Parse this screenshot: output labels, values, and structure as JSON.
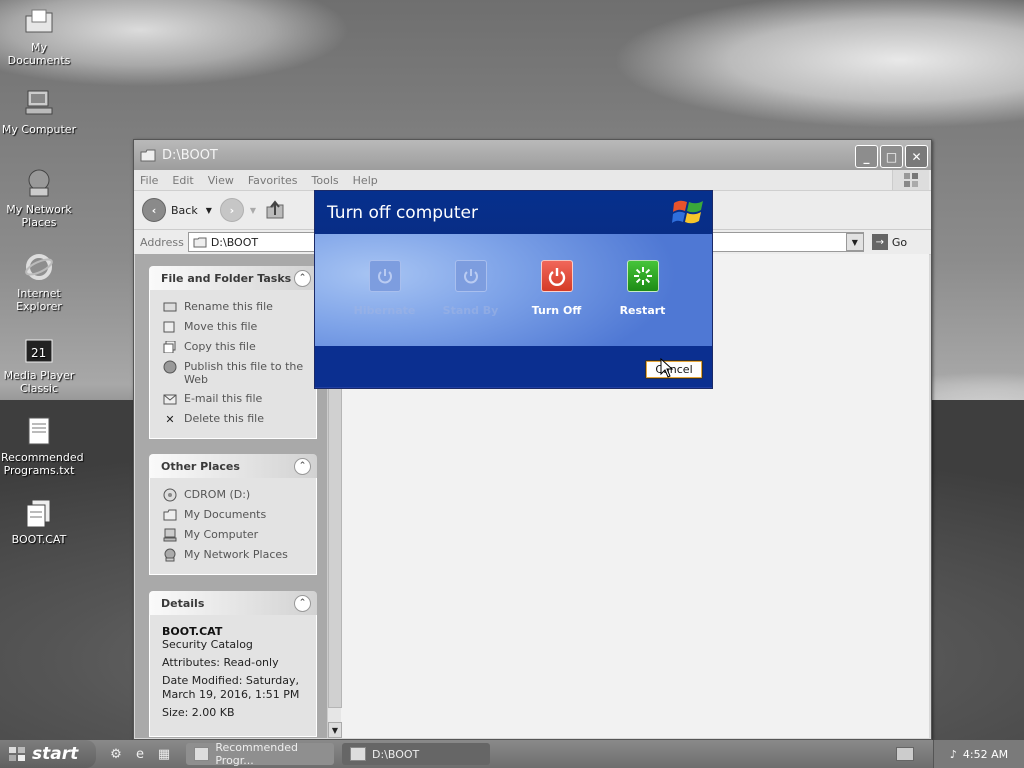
{
  "desktop": {
    "icons": [
      {
        "label": "My Documents",
        "icon": "folder-documents-icon"
      },
      {
        "label": "My Computer",
        "icon": "computer-icon"
      },
      {
        "label": "My Network Places",
        "icon": "network-icon"
      },
      {
        "label": "Internet Explorer",
        "icon": "ie-icon"
      },
      {
        "label": "Media Player Classic",
        "icon": "media-player-icon"
      },
      {
        "label": "Recommended Programs.txt",
        "icon": "text-file-icon"
      },
      {
        "label": "BOOT.CAT",
        "icon": "catalog-file-icon"
      }
    ]
  },
  "window": {
    "title": "D:\\BOOT",
    "menu": [
      "File",
      "Edit",
      "View",
      "Favorites",
      "Tools",
      "Help"
    ],
    "toolbar": {
      "back_label": "Back"
    },
    "address": {
      "label": "Address",
      "value": "D:\\BOOT",
      "go_label": "Go"
    },
    "file_tasks": {
      "title": "File and Folder Tasks",
      "items": [
        "Rename this file",
        "Move this file",
        "Copy this file",
        "Publish this file to the Web",
        "E-mail this file",
        "Delete this file"
      ]
    },
    "other_places": {
      "title": "Other Places",
      "items": [
        "CDROM (D:)",
        "My Documents",
        "My Computer",
        "My Network Places"
      ]
    },
    "details": {
      "title": "Details",
      "name": "BOOT.CAT",
      "type": "Security Catalog",
      "attributes": "Attributes: Read-only",
      "modified": "Date Modified: Saturday, March 19, 2016, 1:51 PM",
      "size": "Size: 2.00 KB"
    }
  },
  "dialog": {
    "title": "Turn off computer",
    "buttons": [
      {
        "label": "Hibernate",
        "state": "disabled"
      },
      {
        "label": "Stand By",
        "state": "disabled"
      },
      {
        "label": "Turn Off",
        "state": "enabled",
        "color": "#d53b26"
      },
      {
        "label": "Restart",
        "state": "enabled",
        "color": "#1d8c16"
      }
    ],
    "cancel_label": "Cancel"
  },
  "taskbar": {
    "start_label": "start",
    "tasks": [
      {
        "label": "Recommended Progr...",
        "active": false
      },
      {
        "label": "D:\\BOOT",
        "active": true
      }
    ],
    "clock": "4:52 AM"
  }
}
